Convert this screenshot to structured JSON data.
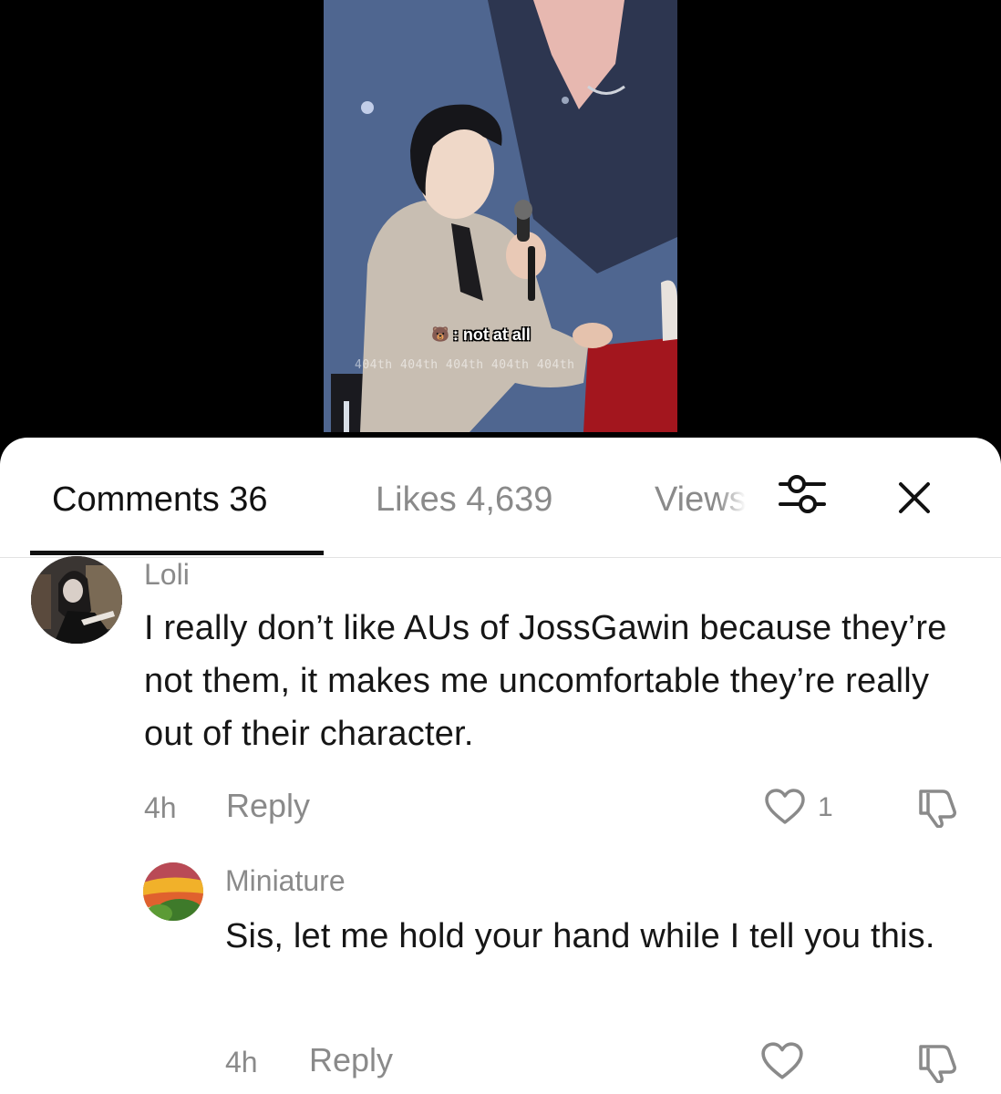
{
  "video": {
    "caption": ": not at all",
    "caption_icon": "bear-face-emoji",
    "watermark": "404th 404th 404th 404th 404th"
  },
  "tabs": [
    {
      "label": "Comments 36",
      "active": true
    },
    {
      "label": "Likes 4,639",
      "active": false
    },
    {
      "label": "Views",
      "active": false
    }
  ],
  "icons": {
    "filter": "sliders-filter-icon",
    "close": "close-icon"
  },
  "comments": [
    {
      "username": "Loli",
      "text": "I really don’t like AUs of JossGawin because they’re not them, it makes me uncomfortable they’re really out of their character.",
      "time": "4h",
      "reply_label": "Reply",
      "likes": "1"
    },
    {
      "username": "Miniature",
      "text": "Sis, let me hold your hand while I tell you this.",
      "time": "4h",
      "reply_label": "Reply",
      "likes": ""
    }
  ],
  "colors": {
    "active_tab": "#111111",
    "inactive_text": "#8a8a8a",
    "sheet_bg": "#ffffff"
  }
}
